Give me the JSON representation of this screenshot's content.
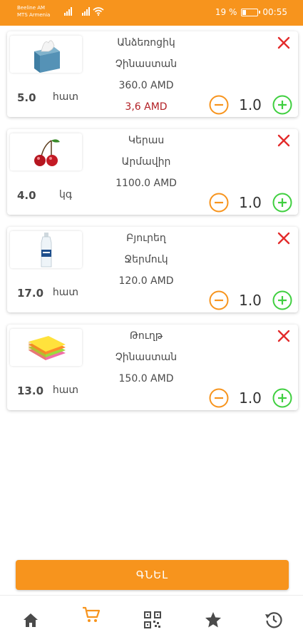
{
  "status_bar": {
    "carrier_1": "Beeline AM",
    "carrier_2": "MTS Armenia",
    "battery_percent": "19 %",
    "battery_level": 0.19,
    "time": "00:55"
  },
  "colors": {
    "accent": "#f7941d",
    "remove": "#e32b2b",
    "add": "#3fcf3f",
    "discount": "#b21f24"
  },
  "cart": {
    "items": [
      {
        "name_line1": "Անձեռոցիկ",
        "name_line2": "Չինաստան",
        "price": "360.0 AMD",
        "discount": "3,6 AMD",
        "stock": "5.0",
        "unit": "հատ",
        "count": "1.0",
        "image_icon": "tissue-box-icon"
      },
      {
        "name_line1": "Կերաս",
        "name_line2": "Արմավիր",
        "price": "1100.0 AMD",
        "stock": "4.0",
        "unit": "կգ",
        "count": "1.0",
        "image_icon": "cherry-icon"
      },
      {
        "name_line1": "Բյուրեղ",
        "name_line2": "Ջերմուկ",
        "price": "120.0 AMD",
        "stock": "17.0",
        "unit": "հատ",
        "count": "1.0",
        "image_icon": "water-bottle-icon"
      },
      {
        "name_line1": "Թուղթ",
        "name_line2": "Չինաստան",
        "price": "150.0 AMD",
        "stock": "13.0",
        "unit": "հատ",
        "count": "1.0",
        "image_icon": "sticky-notes-icon"
      }
    ]
  },
  "buy_button": {
    "label": "ԳՆԵԼ"
  },
  "bottom_nav": {
    "items": [
      {
        "icon": "home-icon",
        "active": false
      },
      {
        "icon": "cart-icon",
        "active": true
      },
      {
        "icon": "qr-code-icon",
        "active": false
      },
      {
        "icon": "star-icon",
        "active": false
      },
      {
        "icon": "history-icon",
        "active": false
      }
    ]
  }
}
